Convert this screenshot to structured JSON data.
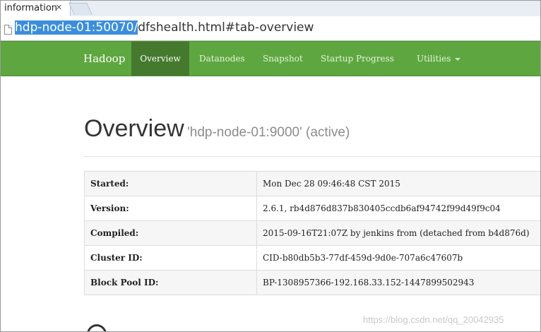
{
  "browser": {
    "tab_title": "information",
    "tab_close_glyph": "×",
    "url_host": "hdp-node-01:50070/",
    "url_rest": "dfshealth.html#tab-overview"
  },
  "navbar": {
    "brand": "Hadoop",
    "items": [
      {
        "label": "Overview",
        "active": true
      },
      {
        "label": "Datanodes",
        "active": false
      },
      {
        "label": "Snapshot",
        "active": false
      },
      {
        "label": "Startup Progress",
        "active": false
      },
      {
        "label": "Utilities",
        "active": false,
        "dropdown": true
      }
    ],
    "color": "#5ea740",
    "active_color": "#44792e"
  },
  "overview": {
    "title": "Overview",
    "subtitle": "'hdp-node-01:9000' (active)",
    "rows": [
      {
        "key": "Started:",
        "value": "Mon Dec 28 09:46:48 CST 2015"
      },
      {
        "key": "Version:",
        "value": "2.6.1, rb4d876d837b830405ccdb6af94742f99d49f9c04"
      },
      {
        "key": "Compiled:",
        "value": "2015-09-16T21:07Z by jenkins from (detached from b4d876d)"
      },
      {
        "key": "Cluster ID:",
        "value": "CID-b80db5b3-77df-459d-9d0e-707a6c47607b"
      },
      {
        "key": "Block Pool ID:",
        "value": "BP-1308957366-192.168.33.152-1447899502943"
      }
    ]
  },
  "watermark": "https://blog.csdn.net/qq_20042935",
  "icons": {
    "page": "page-icon",
    "dropdown": "caret-down-icon"
  }
}
